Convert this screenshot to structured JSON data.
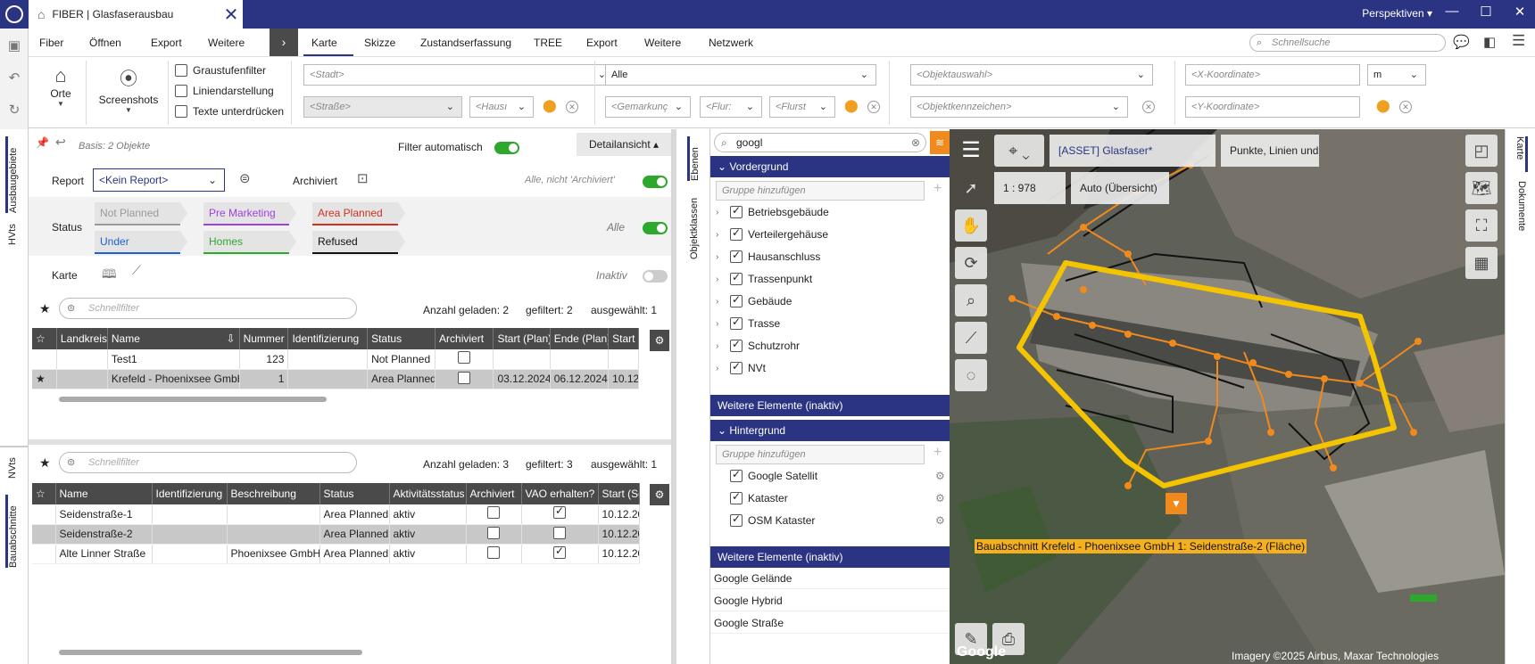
{
  "titlebar": {
    "tab_title": "FIBER | Glasfaserausbau",
    "perspectives": "Perspektiven",
    "accent": "#2b3483"
  },
  "menubar": {
    "left_items": [
      "Fiber",
      "Öffnen",
      "Export",
      "Weitere"
    ],
    "tabs": [
      "Karte",
      "Skizze",
      "Zustandserfassung",
      "TREE",
      "Export",
      "Weitere",
      "Netzwerk"
    ],
    "active_tab": "Karte",
    "search_placeholder": "Schnellsuche"
  },
  "ribbon": {
    "orte": "Orte",
    "screenshots": "Screenshots",
    "checkboxes": [
      {
        "label": "Graustufenfilter",
        "checked": false
      },
      {
        "label": "Liniendarstellung",
        "checked": false
      },
      {
        "label": "Texte unterdrücken",
        "checked": false
      }
    ],
    "stadt": "<Stadt>",
    "strasse": "<Straße>",
    "hausnr": "<Hausı",
    "alle": "Alle",
    "gemarkung": "<Gemarkunç",
    "flur": "<Flur:",
    "flurstueck": "<Flurst",
    "objektauswahl": "<Objektauswahl>",
    "objektkennzeichen": "<Objektkennzeichen>",
    "x_koord": "<X-Koordinate>",
    "y_koord": "<Y-Koordinate>",
    "unit": "m"
  },
  "sidetabs": {
    "ausbaugebiete": "Ausbaugebiete",
    "hvts": "HVts",
    "nvts": "NVts",
    "bauabschnitte": "Bauabschnitte",
    "ebenen": "Ebenen",
    "objektklassen": "Objektklassen",
    "karte": "Karte",
    "dokumente": "Dokumente"
  },
  "upper": {
    "basis": "Basis: 2 Objekte",
    "filter_auto": "Filter automatisch",
    "detail": "Detailansicht",
    "report_label": "Report",
    "report_value": "<Kein Report>",
    "archiviert": "Archiviert",
    "archiviert_hint": "Alle, nicht 'Archiviert'",
    "status_label": "Status",
    "status_alle": "Alle",
    "statuses": [
      {
        "label": "Not Planned",
        "color": "#9a9a9a"
      },
      {
        "label": "Pre Marketing",
        "color": "#a040e0"
      },
      {
        "label": "Area Planned",
        "color": "#d03020"
      },
      {
        "label": "Under Construction",
        "color": "#2060d0"
      },
      {
        "label": "Homes Connected",
        "color": "#2da82d"
      },
      {
        "label": "Refused",
        "color": "#111111"
      }
    ],
    "karte_label": "Karte",
    "inaktiv": "Inaktiv",
    "quickfilter": "Schnellfilter",
    "anzahl_label": "Anzahl geladen:",
    "anzahl": "2",
    "gefiltert_label": "gefiltert:",
    "gefiltert": "2",
    "ausgewaehlt_label": "ausgewählt:",
    "ausgewaehlt": "1",
    "columns": [
      "Landkreis",
      "Name",
      "Nummer",
      "Identifizierung",
      "Status",
      "Archiviert",
      "Start (Plan)",
      "Ende (Plan)",
      "Start ("
    ],
    "rows": [
      {
        "landkreis": "",
        "name": "Test1",
        "nummer": "123",
        "ident": "",
        "status": "Not Planned",
        "archiviert": false,
        "start": "",
        "ende": "",
        "start2": "",
        "selected": false
      },
      {
        "landkreis": "",
        "name": "Krefeld - Phoenixsee GmbH",
        "nummer": "1",
        "ident": "",
        "status": "Area Planned",
        "archiviert": false,
        "start": "03.12.2024",
        "ende": "06.12.2024",
        "start2": "10.12.",
        "selected": true
      }
    ]
  },
  "lower": {
    "quickfilter": "Schnellfilter",
    "anzahl_label": "Anzahl geladen:",
    "anzahl": "3",
    "gefiltert_label": "gefiltert:",
    "gefiltert": "3",
    "ausgewaehlt_label": "ausgewählt:",
    "ausgewaehlt": "1",
    "columns": [
      "Name",
      "Identifizierung",
      "Beschreibung",
      "Status",
      "Aktivitätsstatus",
      "Archiviert",
      "VAO erhalten?",
      "Start (Sc"
    ],
    "rows": [
      {
        "name": "Seidenstraße-1",
        "ident": "",
        "beschr": "",
        "status": "Area Planned",
        "akt": "aktiv",
        "archiviert": false,
        "vao": true,
        "start": "10.12.20",
        "selected": false
      },
      {
        "name": "Seidenstraße-2",
        "ident": "",
        "beschr": "",
        "status": "Area Planned",
        "akt": "aktiv",
        "archiviert": false,
        "vao": false,
        "start": "10.12.20",
        "selected": true
      },
      {
        "name": "Alte Linner Straße",
        "ident": "",
        "beschr": "Phoenixsee GmbH",
        "status": "Area Planned",
        "akt": "aktiv",
        "archiviert": false,
        "vao": true,
        "start": "10.12.20",
        "selected": false
      }
    ]
  },
  "layers": {
    "search": "googl",
    "vordergrund": "Vordergrund",
    "gruppe_hinzufuegen": "Gruppe hinzufügen",
    "foreground_items": [
      "Betriebsgebäude",
      "Verteilergehäuse",
      "Hausanschluss",
      "Trassenpunkt",
      "Gebäude",
      "Trasse",
      "Schutzrohr",
      "NVt"
    ],
    "weitere_inaktiv": "Weitere Elemente (inaktiv)",
    "hintergrund": "Hintergrund",
    "background_items": [
      "Google Satellit",
      "Kataster",
      "OSM Kataster"
    ],
    "more_items": [
      "Google Gelände",
      "Google Hybrid",
      "Google Straße"
    ]
  },
  "map": {
    "asset": "[ASSET] Glasfaser*",
    "geom": "Punkte, Linien und Te",
    "scale": "1 : 978",
    "mode": "Auto (Übersicht)",
    "label": "Bauabschnitt Krefeld - Phoenixsee GmbH 1: Seidenstraße-2 (Fläche)",
    "attribution": "Imagery ©2025 Airbus, Maxar Technologies",
    "logo": "Google",
    "outline_color": "#f5c400",
    "network_color": "#f08a1c"
  }
}
